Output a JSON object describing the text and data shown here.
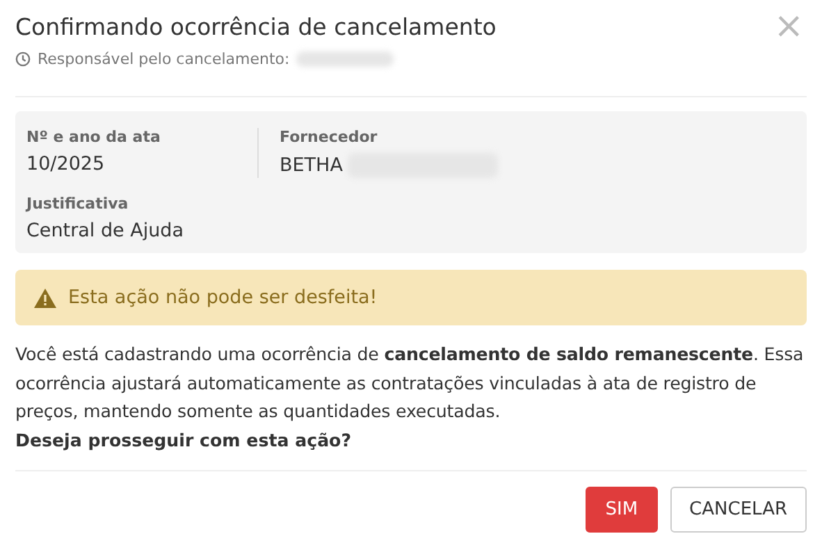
{
  "dialog": {
    "title": "Confirmando ocorrência de cancelamento",
    "close": "×",
    "subtitle": "Responsável pelo cancelamento:"
  },
  "info": {
    "fields": [
      {
        "label": "Nº e ano da ata",
        "value": "10/2025",
        "redacted": false
      },
      {
        "label": "Fornecedor",
        "value": "BETHA",
        "redacted": true
      },
      {
        "label": "Justificativa",
        "value": "Central de Ajuda",
        "redacted": false
      }
    ]
  },
  "warning": {
    "text": "Esta ação não pode ser desfeita!"
  },
  "message": {
    "text": "Você está cadastrando uma ocorrência de **cancelamento de saldo remanescente**. Essa ocorrência ajustará automaticamente as contratações vinculadas à ata de registro de preços, mantendo somente as quantidades executadas.",
    "question": "Deseja prosseguir com esta ação?"
  },
  "buttons": [
    {
      "label": "SIM",
      "kind": "primary"
    },
    {
      "label": "CANCELAR",
      "kind": "secondary"
    }
  ]
}
